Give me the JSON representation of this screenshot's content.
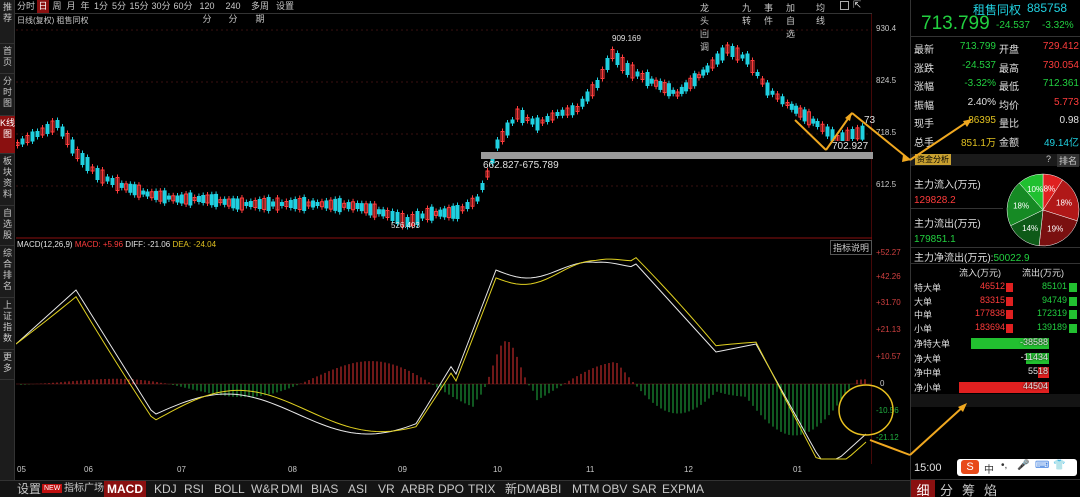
{
  "left_menu": [
    {
      "label": "推荐"
    },
    {
      "label": "首页"
    },
    {
      "label": "分时图"
    },
    {
      "label": "K线图"
    },
    {
      "label": "板块资料"
    },
    {
      "label": "自选股"
    },
    {
      "label": "综合排名"
    },
    {
      "label": "上证指数"
    },
    {
      "label": "更多"
    }
  ],
  "toolbar": {
    "periods": [
      "分时",
      "日",
      "周",
      "月",
      "年",
      "1分",
      "5分",
      "15分",
      "30分",
      "60分",
      "120分",
      "240分",
      "多周期",
      "设置"
    ],
    "active_period": "日",
    "right_items": [
      "龙头回调",
      "九转",
      "事件",
      "加自选",
      "均线"
    ]
  },
  "chart_subtitle": "日线(复权)  租售同权",
  "price_axis": [
    "930.4",
    "824.5",
    "718.5",
    "612.5"
  ],
  "price_annotations": {
    "high": "909.169",
    "low": "526.403",
    "gap": "662.827-675.789",
    "current": "702.927",
    "near_current": "73"
  },
  "macd": {
    "label": "MACD(12,26,9)",
    "macd_value": "MACD: +5.96",
    "diff": "DIFF: -21.06",
    "dea": "DEA: -24.04",
    "indicator_button": "指标说明",
    "axis": [
      "+52.27",
      "+42.26",
      "+31.70",
      "+21.13",
      "+10.57",
      "0",
      "-10.56",
      "-21.12"
    ]
  },
  "dates": [
    "05",
    "06",
    "07",
    "08",
    "09",
    "10",
    "11",
    "12",
    "01"
  ],
  "bottom_tabs": {
    "settings": "设置",
    "new_badge": "NEW",
    "plaza": "指标广场",
    "indicators": [
      "MACD",
      "KDJ",
      "RSI",
      "BOLL",
      "W&R",
      "DMI",
      "BIAS",
      "ASI",
      "VR",
      "ARBR",
      "DPO",
      "TRIX",
      "新DMA",
      "BBI",
      "MTM",
      "OBV",
      "SAR",
      "EXPMA"
    ],
    "active": "MACD"
  },
  "quote": {
    "name": "租售同权",
    "code": "885758",
    "price": "713.799",
    "change": "-24.537",
    "change_pct": "-3.32%",
    "rows": [
      {
        "l1": "最新",
        "v1": "713.799",
        "l2": "开盘",
        "v2": "729.412",
        "c1": "green",
        "c2": "red"
      },
      {
        "l1": "涨跌",
        "v1": "-24.537",
        "l2": "最高",
        "v2": "730.054",
        "c1": "green",
        "c2": "red"
      },
      {
        "l1": "涨幅",
        "v1": "-3.32%",
        "l2": "最低",
        "v2": "712.361",
        "c1": "green",
        "c2": "green"
      },
      {
        "l1": "振幅",
        "v1": "2.40%",
        "l2": "均价",
        "v2": "5.773",
        "c1": "white",
        "c2": "red"
      },
      {
        "l1": "现手",
        "v1": "86395",
        "l2": "量比",
        "v2": "0.98",
        "c1": "yellow",
        "c2": "white"
      },
      {
        "l1": "总手",
        "v1": "851.1万",
        "l2": "金额",
        "v2": "49.14亿",
        "c1": "yellow",
        "c2": "cyan"
      }
    ]
  },
  "fund_flow": {
    "header": "资金分析",
    "help": "?",
    "rank": "排名",
    "inflow_label": "主力流入(万元)",
    "inflow_value": "129828.2",
    "outflow_label": "主力流出(万元)",
    "outflow_value": "179851.1",
    "net_label": "主力净流出(万元):",
    "net_value": "50022.9",
    "pie": [
      {
        "pct": 8,
        "label": "8%",
        "color": "#e02020"
      },
      {
        "pct": 18,
        "label": "18%",
        "color": "#b01818"
      },
      {
        "pct": 19,
        "label": "19%",
        "color": "#7a1010"
      },
      {
        "pct": 14,
        "label": "14%",
        "color": "#0e5a18"
      },
      {
        "pct": 18,
        "label": "18%",
        "color": "#168a24"
      },
      {
        "pct": 10,
        "label": "10%",
        "color": "#20c030"
      }
    ],
    "table_header": [
      "流入(万元)",
      "流出(万元)"
    ],
    "table": [
      {
        "name": "特大单",
        "in": "46512",
        "out": "85101"
      },
      {
        "name": "大单",
        "in": "83315",
        "out": "94749"
      },
      {
        "name": "中单",
        "in": "177838",
        "out": "172319"
      },
      {
        "name": "小单",
        "in": "183694",
        "out": "139189"
      }
    ],
    "net": [
      {
        "name": "净特大单",
        "value": "-38588",
        "color": "#22c030"
      },
      {
        "name": "净大单",
        "value": "-11434",
        "color": "#22c030"
      },
      {
        "name": "净中单",
        "value": "5518",
        "color": "#e02020"
      },
      {
        "name": "净小单",
        "value": "44504",
        "color": "#e02020"
      }
    ]
  },
  "time": "15:00",
  "bottom_right_tabs": [
    "细",
    "分",
    "筹",
    "焰"
  ],
  "ime_label": "中"
}
